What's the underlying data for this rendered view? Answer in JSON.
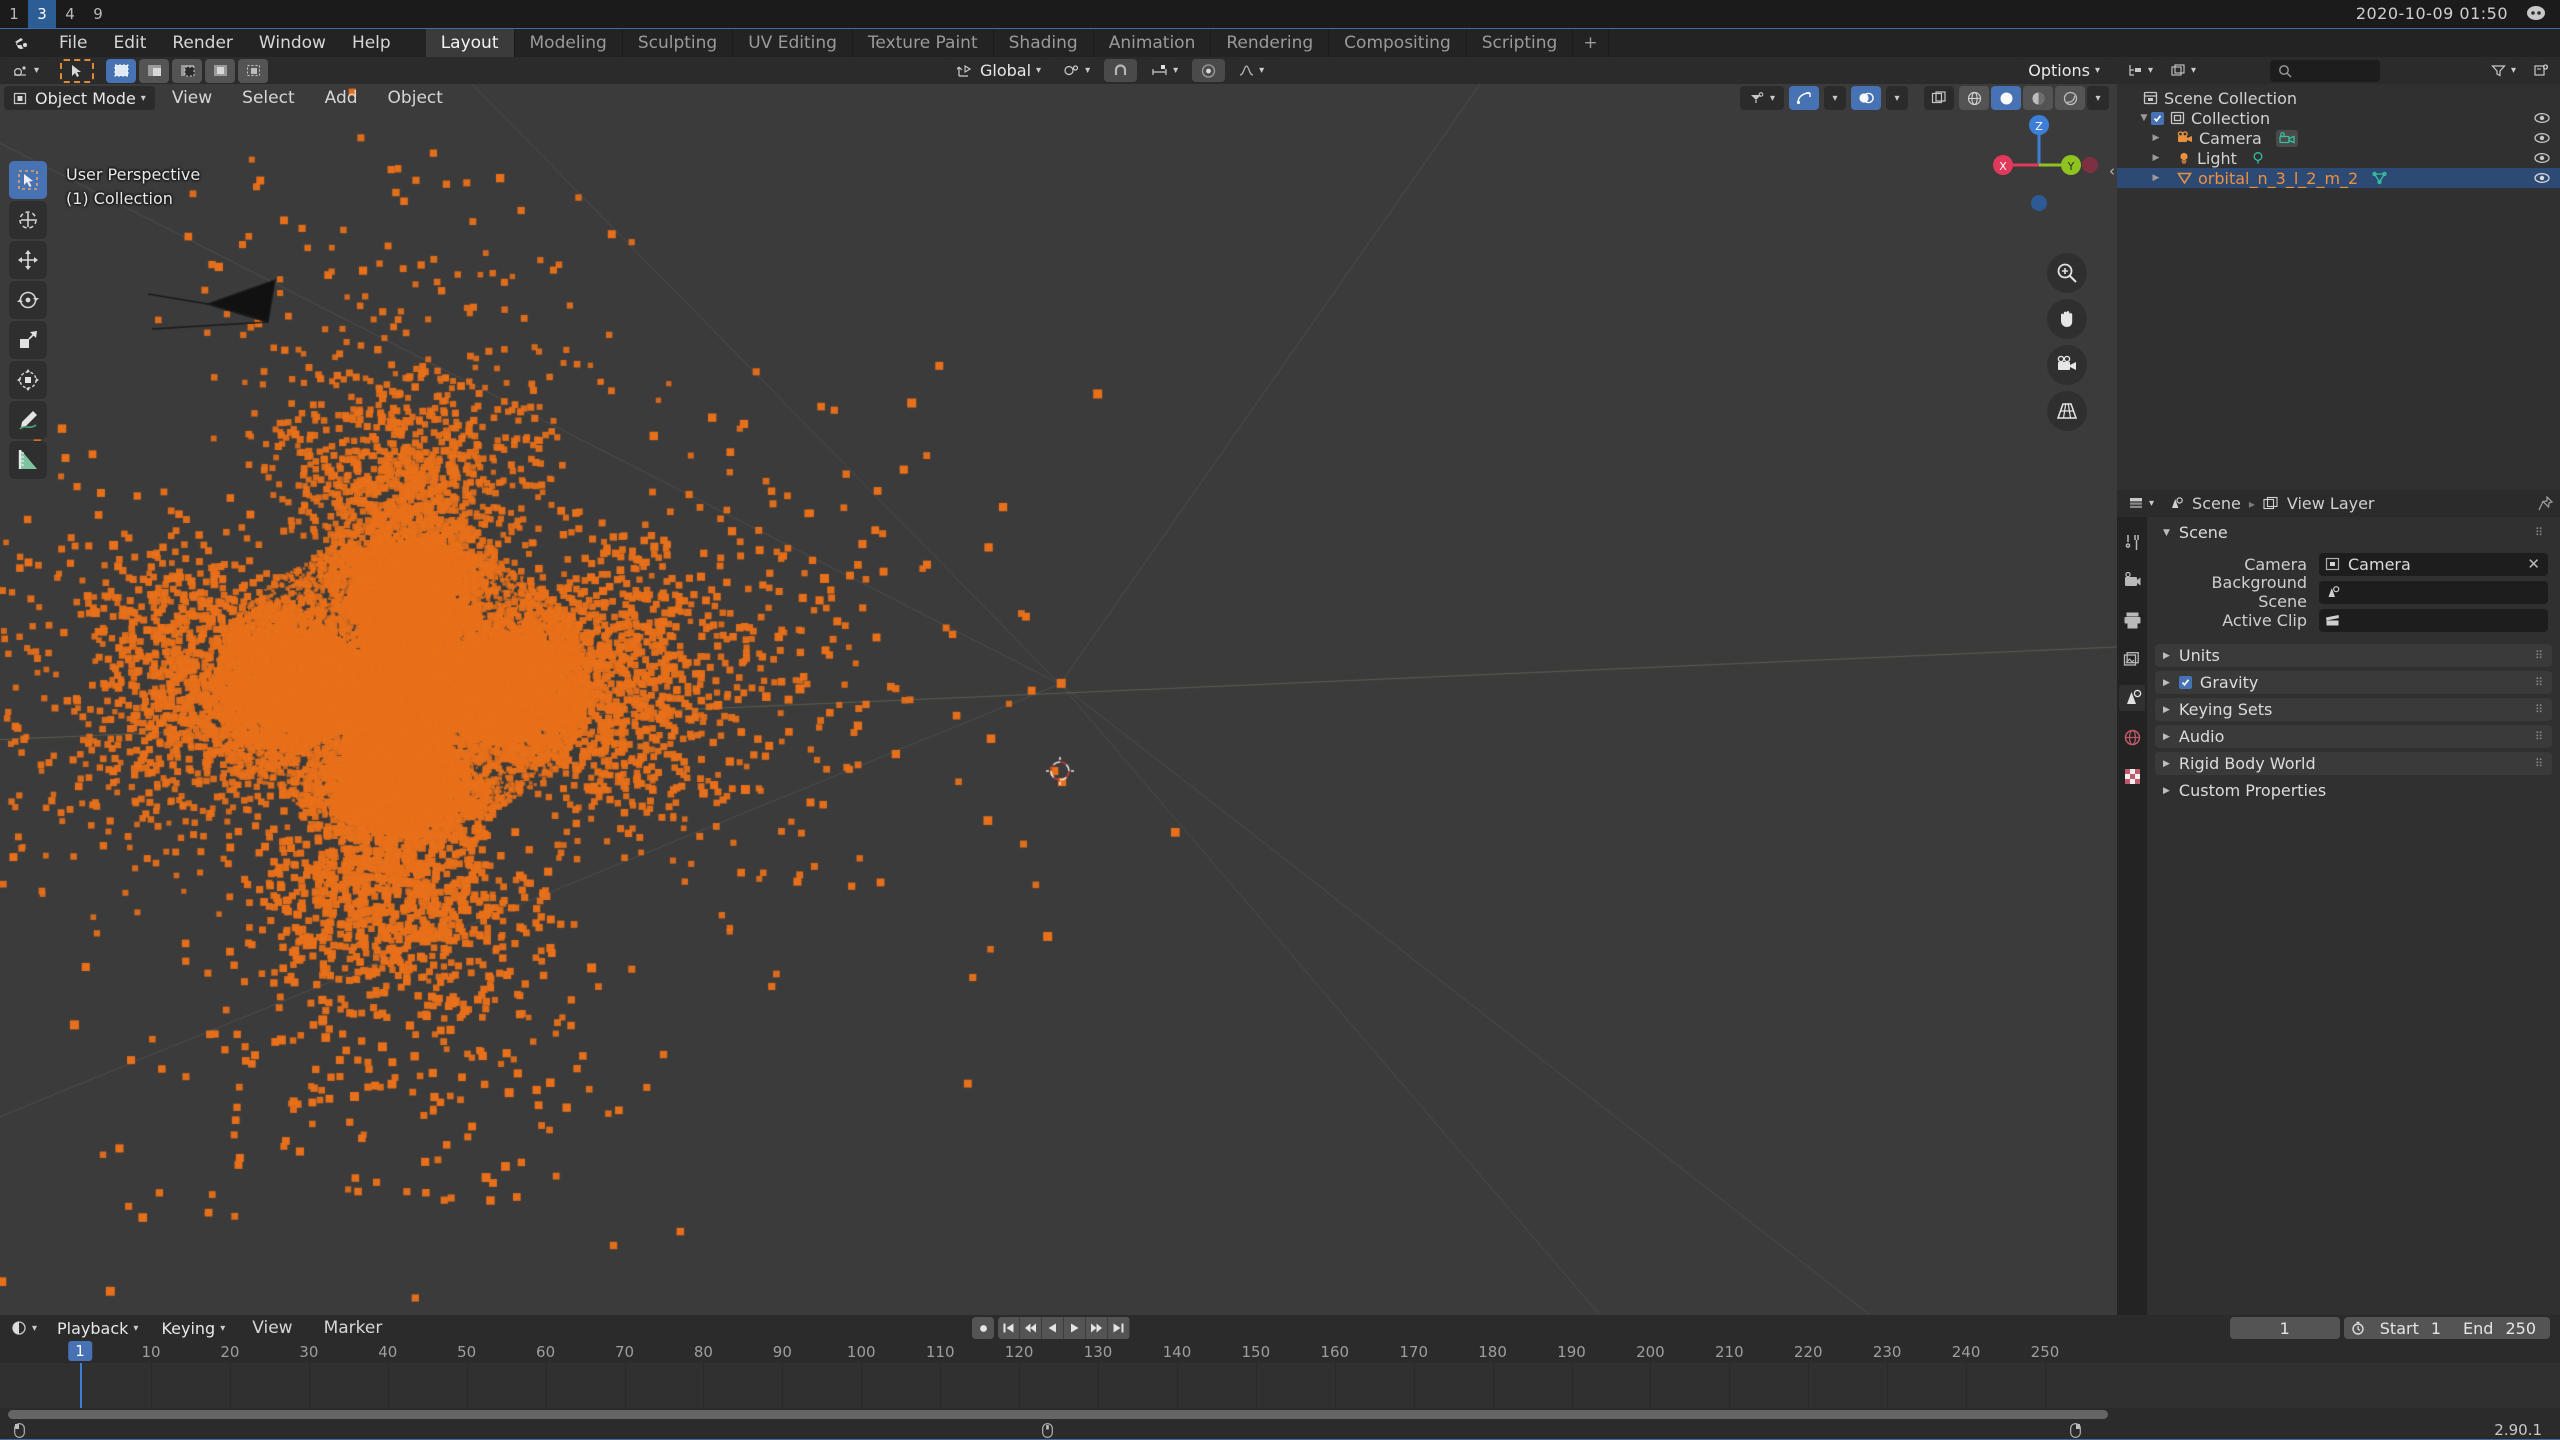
{
  "window": {
    "tabs": [
      "1",
      "3",
      "4",
      "9"
    ],
    "active_tab": "3",
    "clock": "2020-10-09  01:50",
    "app_icon": "discord-icon"
  },
  "topbar": {
    "logo": "blender-logo-icon",
    "menus": [
      "File",
      "Edit",
      "Render",
      "Window",
      "Help"
    ],
    "workspaces": [
      "Layout",
      "Modeling",
      "Sculpting",
      "UV Editing",
      "Texture Paint",
      "Shading",
      "Animation",
      "Rendering",
      "Compositing",
      "Scripting"
    ],
    "active_workspace": "Layout",
    "add_workspace": "+",
    "scene_name": "Scene",
    "view_layer_name": "View Layer",
    "scene_icon": "scene-icon",
    "view_layer_icon": "view-layer-icon",
    "new_icon": "new-copy-icon",
    "remove_icon": "x-icon"
  },
  "viewport": {
    "editor_type_icon": "editor-type-icon",
    "mode": "Object Mode",
    "menus": [
      "View",
      "Select",
      "Add",
      "Object"
    ],
    "select_modes": [
      "set",
      "extend",
      "subtract",
      "invert",
      "intersect"
    ],
    "active_select_mode": "set",
    "cursor_tool_icon": "cursor-select-icon",
    "transform_orientation": "Global",
    "transform_orientation_icon": "orientation-icon",
    "pivot_icon": "pivot-point-icon",
    "snap_icon": "magnet-icon",
    "snap_target_icon": "snap-increment-icon",
    "proportional_icon": "proportional-edit-icon",
    "falloff_icon": "falloff-curve-icon",
    "options_label": "Options",
    "overlay_line1": "User Perspective",
    "overlay_line2": "(1) Collection",
    "visibility_icon": "show-hide-icon",
    "gizmo_icon": "gizmo-icon",
    "overlays_icon": "overlays-icon",
    "xray_icon": "xray-icon",
    "shading_modes": [
      "wireframe",
      "solid",
      "material-preview",
      "rendered"
    ],
    "active_shading": "solid",
    "tools": [
      {
        "name": "tweak-select-box-tool",
        "active": true
      },
      {
        "name": "cursor-tool",
        "active": false
      },
      {
        "name": "move-tool",
        "active": false
      },
      {
        "name": "rotate-tool",
        "active": false
      },
      {
        "name": "scale-tool",
        "active": false
      },
      {
        "name": "transform-tool",
        "active": false
      },
      {
        "name": "annotate-tool",
        "active": false
      },
      {
        "name": "measure-tool",
        "active": false
      }
    ],
    "gizmo_axes": [
      "X",
      "Y",
      "Z"
    ],
    "nav_buttons": [
      "zoom-icon",
      "pan-hand-icon",
      "camera-view-icon",
      "toggle-perspective-icon"
    ],
    "scene_object_color": "#e8701a",
    "background_color": "#3b3b3b"
  },
  "outliner": {
    "display_mode_icon": "outliner-display-mode-icon",
    "filter_scene_icon": "scene-data-icon",
    "search_icon": "search-icon",
    "search_placeholder": "",
    "filter_icon": "filter-funnel-icon",
    "new_collection_icon": "new-collection-icon",
    "rows": [
      {
        "label": "Scene Collection",
        "icon": "scene-collection-icon",
        "indent": 0,
        "disclosure": "",
        "checkbox": false,
        "eye": false,
        "selected": false,
        "datatype": ""
      },
      {
        "label": "Collection",
        "icon": "collection-icon",
        "indent": 1,
        "disclosure": "down",
        "checkbox": true,
        "eye": true,
        "selected": false,
        "datatype": ""
      },
      {
        "label": "Camera",
        "icon": "camera-object-icon",
        "indent": 2,
        "disclosure": "right",
        "checkbox": false,
        "eye": true,
        "selected": false,
        "datatype": "camera-data-icon"
      },
      {
        "label": "Light",
        "icon": "light-object-icon",
        "indent": 2,
        "disclosure": "right",
        "checkbox": false,
        "eye": true,
        "selected": false,
        "datatype": "light-data-icon"
      },
      {
        "label": "orbital_n_3_l_2_m_2",
        "icon": "mesh-object-icon",
        "indent": 2,
        "disclosure": "right",
        "checkbox": false,
        "eye": true,
        "selected": true,
        "datatype": "mesh-data-icon"
      }
    ]
  },
  "properties": {
    "editor_icon": "properties-editor-icon",
    "breadcrumb": [
      "Scene",
      "View Layer"
    ],
    "breadcrumb_icons": [
      "scene-icon",
      "view-layer-icon"
    ],
    "pin_icon": "pin-icon",
    "tabs": [
      {
        "name": "tool-tab",
        "icon": "tool-wrench-icon",
        "active": false
      },
      {
        "name": "render-tab",
        "icon": "render-camera-icon",
        "active": false
      },
      {
        "name": "output-tab",
        "icon": "output-printer-icon",
        "active": false
      },
      {
        "name": "view-layer-tab",
        "icon": "view-layer-images-icon",
        "active": false
      },
      {
        "name": "scene-tab",
        "icon": "scene-cone-icon",
        "active": true
      },
      {
        "name": "world-tab",
        "icon": "world-globe-icon",
        "active": false
      },
      {
        "name": "texture-tab",
        "icon": "texture-checker-icon",
        "active": false
      }
    ],
    "panels": [
      {
        "label": "Scene",
        "open": true,
        "checkbox": null
      },
      {
        "label": "Units",
        "open": false,
        "checkbox": null
      },
      {
        "label": "Gravity",
        "open": false,
        "checkbox": true
      },
      {
        "label": "Keying Sets",
        "open": false,
        "checkbox": null
      },
      {
        "label": "Audio",
        "open": false,
        "checkbox": null
      },
      {
        "label": "Rigid Body World",
        "open": false,
        "checkbox": null
      },
      {
        "label": "Custom Properties",
        "open": false,
        "checkbox": null
      }
    ],
    "fields": [
      {
        "label": "Camera",
        "value": "Camera",
        "icon": "camera-data-icon",
        "clear": true
      },
      {
        "label": "Background Scene",
        "value": "",
        "icon": "scene-icon",
        "clear": false
      },
      {
        "label": "Active Clip",
        "value": "",
        "icon": "movie-clip-icon",
        "clear": false
      }
    ]
  },
  "timeline": {
    "editor_icon": "timeline-editor-icon",
    "menus": [
      "Playback",
      "Keying",
      "View",
      "Marker"
    ],
    "playback_buttons": [
      "record-icon",
      "jump-start-icon",
      "prev-keyframe-icon",
      "play-reverse-icon",
      "play-icon",
      "next-keyframe-icon",
      "jump-end-icon"
    ],
    "current_frame": "1",
    "use_preview_range_icon": "preview-range-icon",
    "start_label": "Start",
    "start_value": "1",
    "end_label": "End",
    "end_value": "250",
    "ruler_ticks": [
      10,
      20,
      30,
      40,
      50,
      60,
      70,
      80,
      90,
      100,
      110,
      120,
      130,
      140,
      150,
      160,
      170,
      180,
      190,
      200,
      210,
      220,
      230,
      240,
      250
    ],
    "playhead_frame": "1"
  },
  "statusbar": {
    "hints": [
      {
        "icon": "mouse-left-icon",
        "text": ""
      },
      {
        "icon": "mouse-middle-icon",
        "text": ""
      },
      {
        "icon": "mouse-right-icon",
        "text": ""
      }
    ],
    "version": "2.90.1"
  }
}
